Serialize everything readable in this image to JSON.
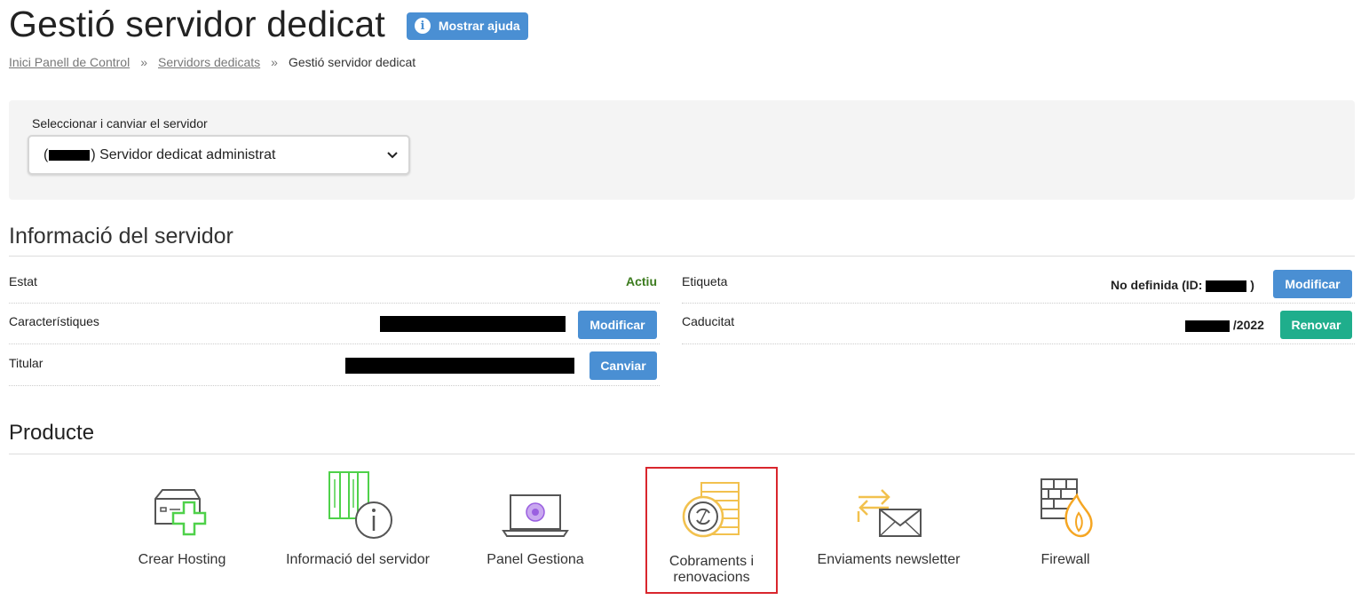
{
  "header": {
    "title": "Gestió servidor dedicat",
    "help_label": "Mostrar ajuda"
  },
  "breadcrumb": {
    "items": [
      "Inici Panell de Control",
      "Servidors dedicats",
      "Gestió servidor dedicat"
    ],
    "sep": "»"
  },
  "selector": {
    "label": "Seleccionar i canviar el servidor",
    "open_paren": "(",
    "value": ") Servidor dedicat administrat"
  },
  "server_info": {
    "title": "Informació del servidor",
    "estat": {
      "label": "Estat",
      "value": "Actiu"
    },
    "caracteristiques": {
      "label": "Característiques",
      "button": "Modificar"
    },
    "titular": {
      "label": "Titular",
      "button": "Canviar"
    },
    "etiqueta": {
      "label": "Etiqueta",
      "value_prefix": "No definida (ID:",
      "value_suffix": ")",
      "button": "Modificar"
    },
    "caducitat": {
      "label": "Caducitat",
      "value_suffix": "/2022",
      "button": "Renovar"
    }
  },
  "product": {
    "title": "Producte",
    "items": [
      "Crear Hosting",
      "Informació del servidor",
      "Panel Gestiona",
      "Cobraments i renovacions",
      "Enviaments newsletter",
      "Firewall"
    ]
  },
  "colors": {
    "accent_blue": "#4a8fd3",
    "accent_green": "#1fae8c",
    "status_green": "#3c7b1e",
    "highlight_red": "#d9262d"
  }
}
